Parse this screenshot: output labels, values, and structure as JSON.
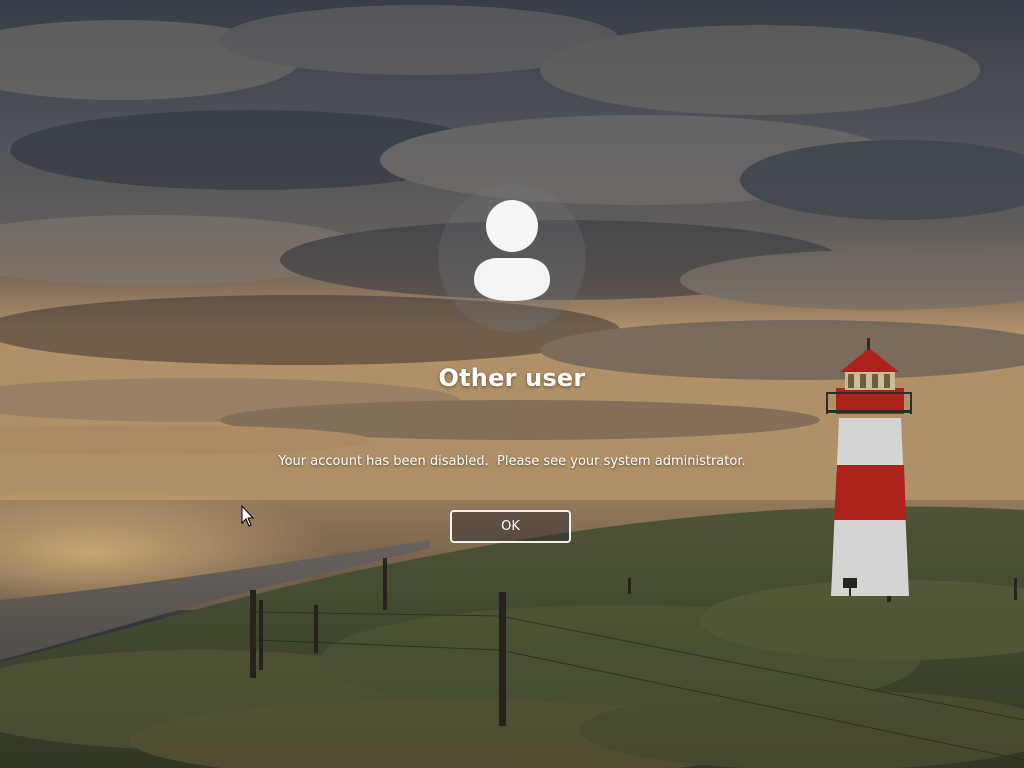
{
  "lock_screen": {
    "user_name": "Other user",
    "message": "Your account has been disabled.  Please see your system administrator.",
    "ok_label": "OK"
  },
  "icons": {
    "avatar": "user-silhouette-icon",
    "cursor": "mouse-pointer-icon"
  },
  "colors": {
    "text": "#ffffff",
    "button_border": "#ffffff",
    "lighthouse_red": "#c8261f",
    "lighthouse_white": "#f2f2f0"
  }
}
